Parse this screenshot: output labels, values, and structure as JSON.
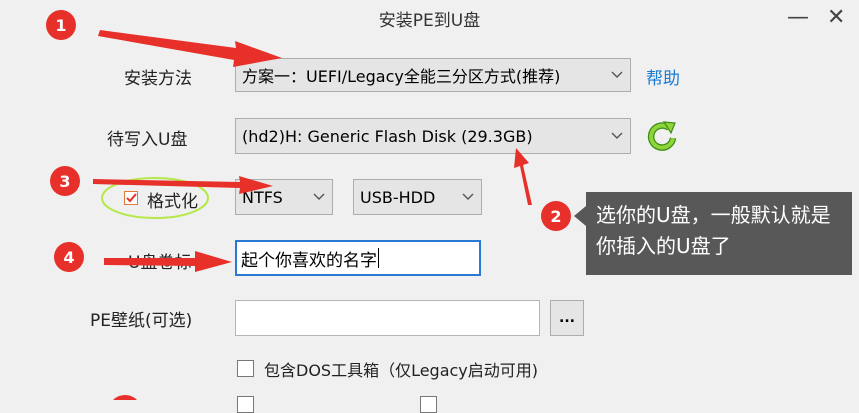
{
  "window": {
    "title": "安装PE到U盘",
    "minimize_glyph": "—",
    "close_glyph": "✕"
  },
  "form": {
    "install_method": {
      "label": "安装方法",
      "value": "方案一：UEFI/Legacy全能三分区方式(推荐)",
      "help_link": "帮助"
    },
    "target_disk": {
      "label": "待写入U盘",
      "value": "(hd2)H: Generic Flash Disk (29.3GB)",
      "refresh_icon": "refresh-icon"
    },
    "format": {
      "checkbox_label": "格式化",
      "checked": true,
      "filesystem": "NTFS",
      "boot_mode": "USB-HDD"
    },
    "volume_label": {
      "label": "U盘卷标",
      "value": "起个你喜欢的名字"
    },
    "wallpaper": {
      "label": "PE壁纸(可选)",
      "value": "",
      "browse_label": "..."
    },
    "dos_tools": {
      "label": "包含DOS工具箱（仅Legacy启动可用)",
      "checked": false
    }
  },
  "annotations": {
    "markers": [
      "1",
      "2",
      "3",
      "4"
    ],
    "tooltip_text": "选你的U盘，一般默认就是你插入的U盘了",
    "accent_color": "#e8302a",
    "highlight_color": "#b6e84a"
  }
}
